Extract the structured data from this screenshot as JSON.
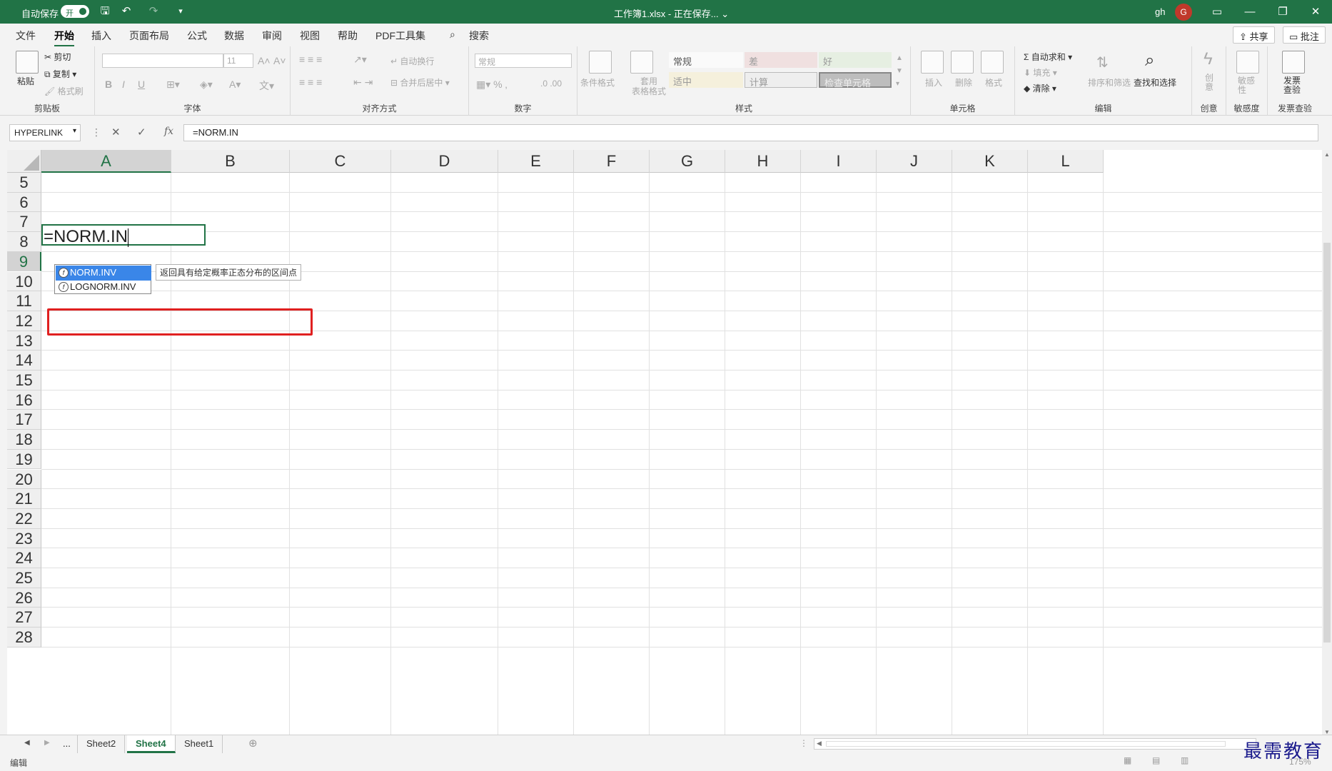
{
  "titlebar": {
    "autosave_label": "自动保存",
    "autosave_state": "开",
    "doc_title": "工作簿1.xlsx - 正在保存... ⌄",
    "user": "gh",
    "avatar_letter": "G"
  },
  "tabs": [
    "文件",
    "开始",
    "插入",
    "页面布局",
    "公式",
    "数据",
    "审阅",
    "视图",
    "帮助",
    "PDF工具集"
  ],
  "search_label": "搜索",
  "share_label": "共享",
  "comments_label": "批注",
  "ribbon": {
    "clipboard": {
      "paste": "粘贴",
      "cut": "剪切",
      "copy": "复制",
      "format_painter": "格式刷",
      "label": "剪贴板"
    },
    "font": {
      "size": "11",
      "label": "字体",
      "bold": "B",
      "italic": "I",
      "underline": "U"
    },
    "align": {
      "wrap": "自动换行",
      "merge": "合并后居中",
      "label": "对齐方式"
    },
    "number": {
      "format": "常规",
      "label": "数字"
    },
    "styles": {
      "cond": "条件格式",
      "table": "套用\n表格格式",
      "s_normal": "常规",
      "s_bad": "差",
      "s_good": "好",
      "s_neutral": "适中",
      "s_calc": "计算",
      "s_check": "检查单元格",
      "label": "样式"
    },
    "cells": {
      "insert": "插入",
      "delete": "删除",
      "format": "格式",
      "label": "单元格"
    },
    "editing": {
      "autosum": "自动求和",
      "fill": "填充",
      "clear": "清除",
      "sort": "排序和筛选",
      "find": "查找和选择",
      "label": "编辑"
    },
    "creative": {
      "btn": "创\n意",
      "label": "创意"
    },
    "sensitivity": {
      "btn": "敏感\n性",
      "label": "敏感度"
    },
    "invoice": {
      "btn": "发票\n查验",
      "label": "发票查验"
    }
  },
  "formula_bar": {
    "namebox": "HYPERLINK",
    "fx": "fx",
    "formula": "=NORM.IN"
  },
  "columns": [
    "A",
    "B",
    "C",
    "D",
    "E",
    "F",
    "G",
    "H",
    "I",
    "J",
    "K",
    "L"
  ],
  "rows": [
    "5",
    "6",
    "7",
    "8",
    "9",
    "10",
    "11",
    "12",
    "13",
    "14",
    "15",
    "16",
    "17",
    "18",
    "19",
    "20",
    "21",
    "22",
    "23",
    "24",
    "25",
    "26",
    "27",
    "28"
  ],
  "active_cell": {
    "row": "9",
    "column": "A",
    "text": "=NORM.IN"
  },
  "autocomplete": {
    "items": [
      "NORM.INV",
      "LOGNORM.INV"
    ],
    "selected": "NORM.INV",
    "tooltip": "返回具有给定概率正态分布的区间点"
  },
  "sheets": {
    "more": "...",
    "tabs": [
      "Sheet2",
      "Sheet4",
      "Sheet1"
    ],
    "active": "Sheet4"
  },
  "status": {
    "mode": "编辑",
    "zoom": "175%"
  },
  "watermark": "最需教育",
  "colors": {
    "accent": "#217346",
    "highlight": "#e02020",
    "selection": "#3a86e8"
  }
}
